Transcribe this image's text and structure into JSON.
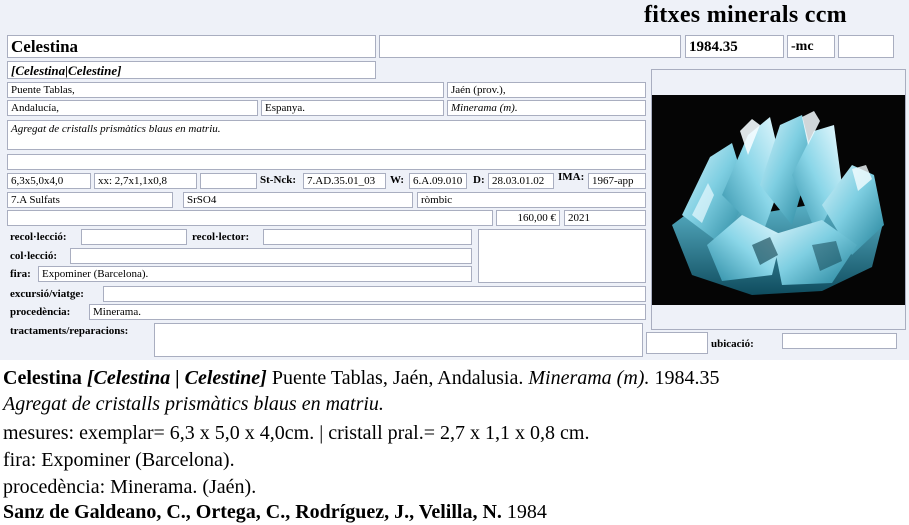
{
  "header": {
    "title": "fitxes minerals ccm"
  },
  "card": {
    "name": "Celestina",
    "synonyms": "[Celestina|Celestine]",
    "number": "1984.35",
    "suffix": "-mc",
    "locality": "Puente Tablas,",
    "province": "Jaén (prov.),",
    "region": "Andalucía,",
    "country": "Espanya.",
    "dealer": "Minerama (m).",
    "description": "Agregat de cristalls prismàtics blaus en matriu.",
    "size": "6,3x5,0x4,0",
    "crystal": "xx: 2,7x1,1x0,8",
    "strunz_label": "St-Nck:",
    "strunz": "7.AD.35.01_03",
    "w_label": "W:",
    "w": "6.A.09.010",
    "d_label": "D:",
    "d": "28.03.01.02",
    "ima_label": "IMA:",
    "ima": "1967-app",
    "class": "7.A Sulfats",
    "formula": "SrSO4",
    "system": "ròmbic",
    "price": "160,00 €",
    "year": "2021",
    "recolleccio_label": "recol·lecció:",
    "recollector_label": "recol·lector:",
    "colleccio_label": "col·lecció:",
    "fira_label": "fira:",
    "fira": "Expominer (Barcelona).",
    "excursio_label": "excursió/viatge:",
    "procedencia_label": "procedència:",
    "procedencia": "Minerama.",
    "tractaments_label": "tractaments/reparacions:",
    "ubicacio_label": "ubicació:"
  },
  "photo": {
    "subject": "blue celestine crystal cluster on black background"
  },
  "caption": {
    "l1_name": "Celestina",
    "l1_syn": "[Celestina | Celestine]",
    "l1_loc": "Puente Tablas, Jaén, Andalusia.",
    "l1_dealer": "Minerama (m).",
    "l1_num": "1984.35",
    "l2": "Agregat de cristalls prismàtics blaus en matriu.",
    "l3": "mesures: exemplar= 6,3 x 5,0 x 4,0cm. | cristall pral.= 2,7 x 1,1 x 0,8 cm.",
    "l4": "fira: Expominer (Barcelona).",
    "l5": "procedència: Minerama. (Jaén).",
    "l6_authors": "Sanz de Galdeano, C., Ortega, C., Rodríguez, J., Velilla, N.",
    "l6_year": "1984"
  },
  "colors": {
    "card_bg": "#eef1f8",
    "field_border": "#a9aec0",
    "crystal": "#6fc3d8"
  }
}
